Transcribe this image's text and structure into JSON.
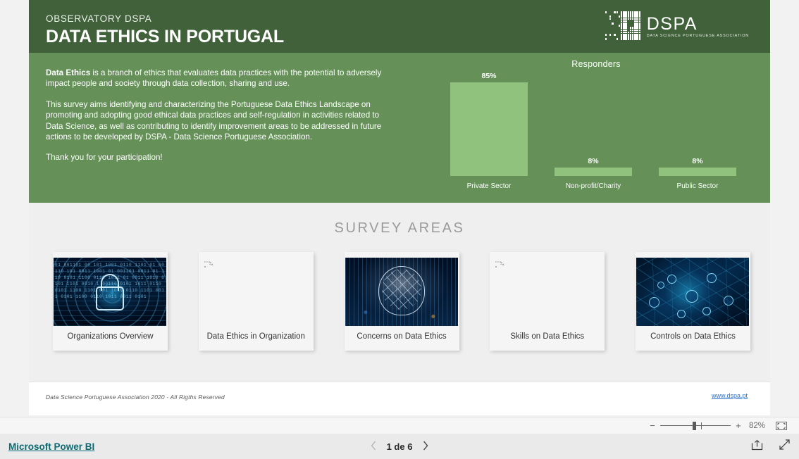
{
  "report": {
    "eyebrow": "OBSERVATORY DSPA",
    "title": "DATA ETHICS IN PORTUGAL",
    "logo": {
      "word": "DSPA",
      "subtitle": "DATA SCIENCE PORTUGUESE ASSOCIATION"
    },
    "intro": {
      "lead_bold": "Data Ethics",
      "paragraph_1": " is a  branch of ethics that evaluates data practices with the potential to adversely impact people and society through data collection, sharing and use.",
      "paragraph_2": "This survey aims identifying  and characterizing the Portuguese Data Ethics Landscape on promoting and adopting good ethical data practices and self-regulation in activities related to Data Science, as well as contributing to identify improvement areas to be addressed in future actions to be developed by DSPA - Data Science Portuguese Association.",
      "paragraph_3": "Thank you for your participation!"
    },
    "areas_heading": "SURVEY AREAS",
    "cards": [
      {
        "label": "Organizations Overview",
        "image": "padlock-binary-security-image",
        "broken": false
      },
      {
        "label": "Data Ethics in Organization",
        "image": "broken-image-placeholder",
        "broken": true
      },
      {
        "label": "Concerns on Data Ethics",
        "image": "ai-brain-head-network-image",
        "broken": false
      },
      {
        "label": "Skills on Data Ethics",
        "image": "broken-image-placeholder",
        "broken": true
      },
      {
        "label": "Controls on Data Ethics",
        "image": "blue-network-nodes-image",
        "broken": false
      }
    ],
    "footer": {
      "copyright": "Data Science Portuguese Association 2020 - All Rigths Reserved",
      "link": "www.dspa.pt"
    },
    "colors": {
      "header_dark_green": "#41613a",
      "header_green": "#659159",
      "bar_green": "#90c27e",
      "canvas_gray": "#efefef",
      "link_blue": "#2a6fc9",
      "brand_teal": "#0b6a72"
    }
  },
  "chart_data": {
    "type": "bar",
    "title": "Responders",
    "categories": [
      "Private Sector",
      "Non-profit/Charity",
      "Public Sector"
    ],
    "values": [
      85,
      8,
      8
    ],
    "value_labels": [
      "85%",
      "8%",
      "8%"
    ],
    "unit": "%",
    "xlabel": "",
    "ylabel": "",
    "ylim": [
      0,
      85
    ],
    "grid": false,
    "legend": "none",
    "bar_color": "#90c27e",
    "background": "#659159"
  },
  "zoombar": {
    "minus": "−",
    "plus": "+",
    "zoom_level": "82%",
    "fit_icon": "fit-to-page-icon"
  },
  "appbar": {
    "brand": "Microsoft Power BI",
    "page_label": "1 de 6",
    "prev_icon": "chevron-left-icon",
    "next_icon": "chevron-right-icon",
    "share_icon": "share-icon",
    "fullscreen_icon": "fullscreen-icon"
  }
}
